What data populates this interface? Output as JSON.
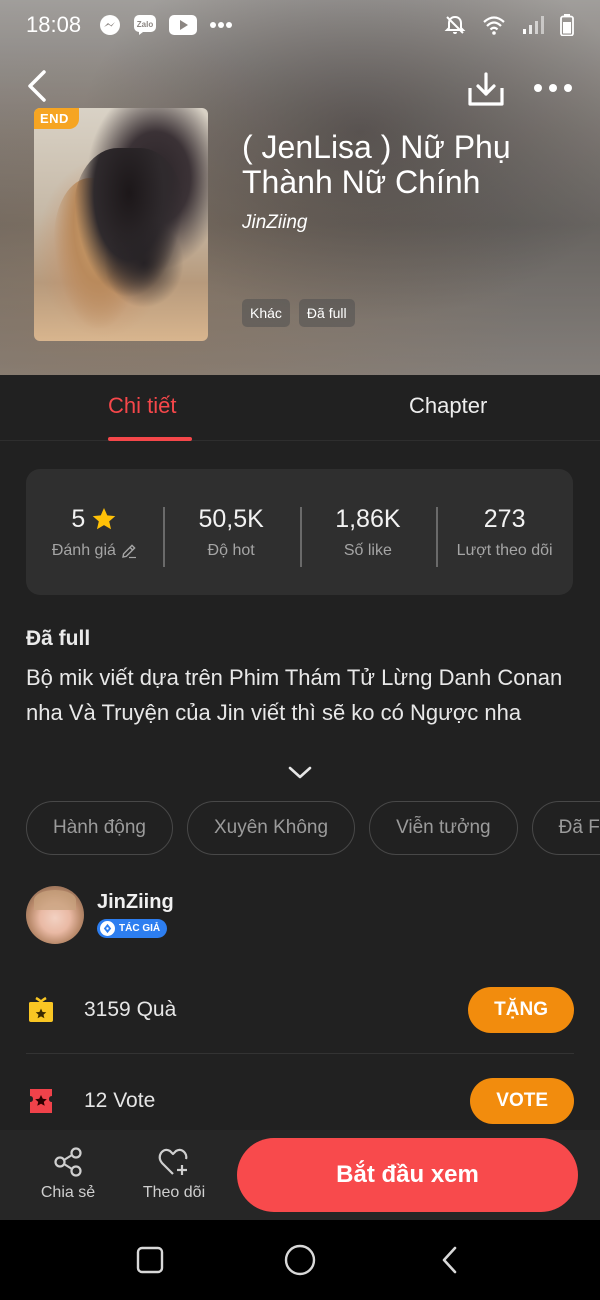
{
  "status_bar": {
    "time": "18:08",
    "left_icons": [
      "messenger-icon",
      "zalo-icon",
      "youtube-icon",
      "more-dots-icon"
    ],
    "right_icons": [
      "bell-off-icon",
      "wifi-icon",
      "signal-icon",
      "battery-icon"
    ]
  },
  "book": {
    "end_badge": "END",
    "title": "( JenLisa ) Nữ Phụ Thành Nữ Chính",
    "author": "JinZiing",
    "tags": [
      "Khác",
      "Đã full"
    ]
  },
  "tabs": {
    "detail": "Chi tiết",
    "chapter": "Chapter",
    "active": "detail"
  },
  "stats": [
    {
      "value": "5",
      "label": "Đánh giá"
    },
    {
      "value": "50,5K",
      "label": "Độ hot"
    },
    {
      "value": "1,86K",
      "label": "Số like"
    },
    {
      "value": "273",
      "label": "Lượt theo dõi"
    }
  ],
  "description": {
    "status": "Đã full",
    "text": "Bộ mik viết dựa trên Phim Thám Tử Lừng Danh Conan nha Và Truyện của Jin viết thì sẽ ko có Ngược nha"
  },
  "genres": [
    "Hành động",
    "Xuyên Không",
    "Viễn tưởng",
    "Đã F"
  ],
  "author_block": {
    "name": "JinZiing",
    "badge": "TÁC GIẢ"
  },
  "gift": {
    "count_text": "3159",
    "unit": "Quà",
    "button": "TẶNG"
  },
  "vote": {
    "count_text": "12",
    "unit": "Vote",
    "button": "VOTE"
  },
  "actions": {
    "share": "Chia sẻ",
    "follow": "Theo dõi",
    "start": "Bắt đầu xem"
  },
  "colors": {
    "accent": "#f5474a",
    "orange": "#f28c0d",
    "badge_blue": "#2d7ef0",
    "star": "#ffc107"
  }
}
